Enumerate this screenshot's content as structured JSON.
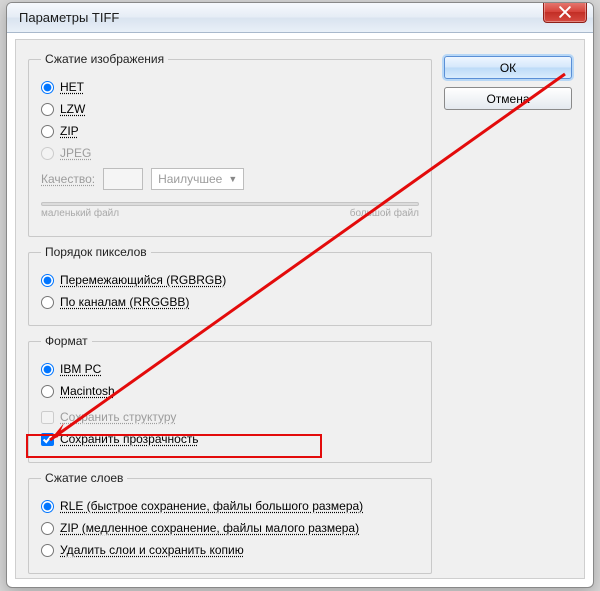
{
  "window": {
    "title": "Параметры TIFF"
  },
  "buttons": {
    "ok": "ОК",
    "cancel": "Отмена"
  },
  "compression": {
    "legend": "Сжатие изображения",
    "none": "НЕТ",
    "lzw": "LZW",
    "zip": "ZIP",
    "jpeg": "JPEG",
    "quality_label": "Качество:",
    "quality_value": "",
    "quality_preset": "Наилучшее",
    "slider_small": "маленький файл",
    "slider_large": "большой файл"
  },
  "pixel_order": {
    "legend": "Порядок пикселов",
    "interleaved": "Перемежающийся (RGBRGB)",
    "per_channel": "По каналам (RRGGBB)"
  },
  "format": {
    "legend": "Формат",
    "ibmpc": "IBM PC",
    "mac": "Macintosh",
    "save_structure": "Сохранить структуру",
    "save_transparency": "Сохранить прозрачность"
  },
  "layer_compression": {
    "legend": "Сжатие слоев",
    "rle": "RLE (быстрое сохранение, файлы большого размера)",
    "zip": "ZIP (медленное сохранение, файлы малого размера)",
    "discard": "Удалить слои и сохранить копию"
  }
}
